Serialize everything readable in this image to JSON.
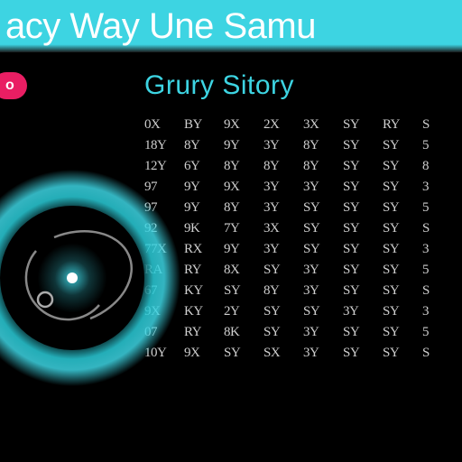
{
  "header": {
    "title": "acy Way Une Samu"
  },
  "badge": {
    "label": "o"
  },
  "subtitle": "Grury Sitory",
  "grid": {
    "rows": [
      [
        "0X",
        "BY",
        "9X",
        "2X",
        "3X",
        "SY",
        "RY",
        "S"
      ],
      [
        "18Y",
        "8Y",
        "9Y",
        "3Y",
        "8Y",
        "SY",
        "SY",
        "5"
      ],
      [
        "12Y",
        "6Y",
        "8Y",
        "8Y",
        "8Y",
        "SY",
        "SY",
        "8"
      ],
      [
        "97",
        "9Y",
        "9X",
        "3Y",
        "3Y",
        "SY",
        "SY",
        "3"
      ],
      [
        "97",
        "9Y",
        "8Y",
        "3Y",
        "SY",
        "SY",
        "SY",
        "5"
      ],
      [
        "92",
        "9K",
        "7Y",
        "3X",
        "SY",
        "SY",
        "SY",
        "S"
      ],
      [
        "77X",
        "RX",
        "9Y",
        "3Y",
        "SY",
        "SY",
        "SY",
        "3"
      ],
      [
        "RA",
        "RY",
        "8X",
        "SY",
        "3Y",
        "SY",
        "SY",
        "5"
      ],
      [
        "67",
        "KY",
        "SY",
        "8Y",
        "3Y",
        "SY",
        "SY",
        "S"
      ],
      [
        "9X",
        "KY",
        "2Y",
        "SY",
        "SY",
        "3Y",
        "SY",
        "3"
      ],
      [
        "07",
        "RY",
        "8K",
        "SY",
        "3Y",
        "SY",
        "SY",
        "5"
      ],
      [
        "10Y",
        "9X",
        "SY",
        "SX",
        "3Y",
        "SY",
        "SY",
        "S"
      ]
    ]
  },
  "colors": {
    "accent": "#3dd4e2",
    "badge": "#e91e63"
  }
}
